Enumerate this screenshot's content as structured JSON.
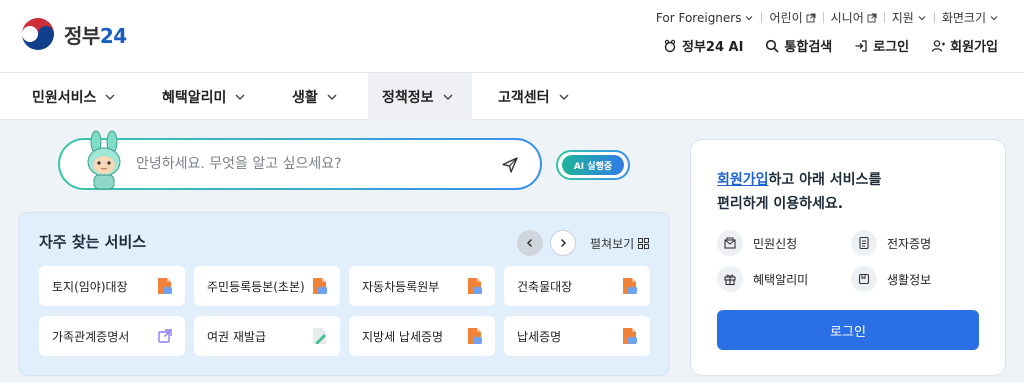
{
  "brand": {
    "name": "정부",
    "num": "24"
  },
  "util": {
    "foreigners": "For Foreigners",
    "kids": "어린이",
    "senior": "시니어",
    "support": "지원",
    "zoom": "화면크기"
  },
  "gnb": {
    "ai": "정부24 AI",
    "search": "통합검색",
    "login": "로그인",
    "signup": "회원가입"
  },
  "nav": {
    "items": [
      "민원서비스",
      "혜택알리미",
      "생활",
      "정책정보",
      "고객센터"
    ],
    "active": "정책정보"
  },
  "search": {
    "placeholder": "안녕하세요. 무엇을 알고 싶으세요?",
    "ai_badge": "AI 실행중"
  },
  "freq": {
    "title": "자주 찾는 서비스",
    "expand": "펼쳐보기",
    "items": [
      {
        "label": "토지(임야)대장",
        "icon": "document-icon"
      },
      {
        "label": "주민등록등본(초본)",
        "icon": "document-icon"
      },
      {
        "label": "자동차등록원부",
        "icon": "document-icon"
      },
      {
        "label": "건축물대장",
        "icon": "document-icon"
      },
      {
        "label": "가족관계증명서",
        "icon": "external-link-icon"
      },
      {
        "label": "여권 재발급",
        "icon": "edit-document-icon"
      },
      {
        "label": "지방세 납세증명",
        "icon": "document-icon"
      },
      {
        "label": "납세증명",
        "icon": "document-icon"
      }
    ]
  },
  "card": {
    "link": "회원가입",
    "line1_rest": "하고 아래 서비스를",
    "line2": "편리하게 이용하세요.",
    "items": [
      "민원신청",
      "전자증명",
      "혜택알리미",
      "생활정보"
    ],
    "login_button": "로그인"
  },
  "colors": {
    "primary": "#2b6fe6",
    "link": "#1e62d0",
    "doc_orange": "#f0823a",
    "gradient_start": "#38c6a6",
    "gradient_end": "#3a8ff0",
    "panel_bg": "#e1eefb"
  }
}
